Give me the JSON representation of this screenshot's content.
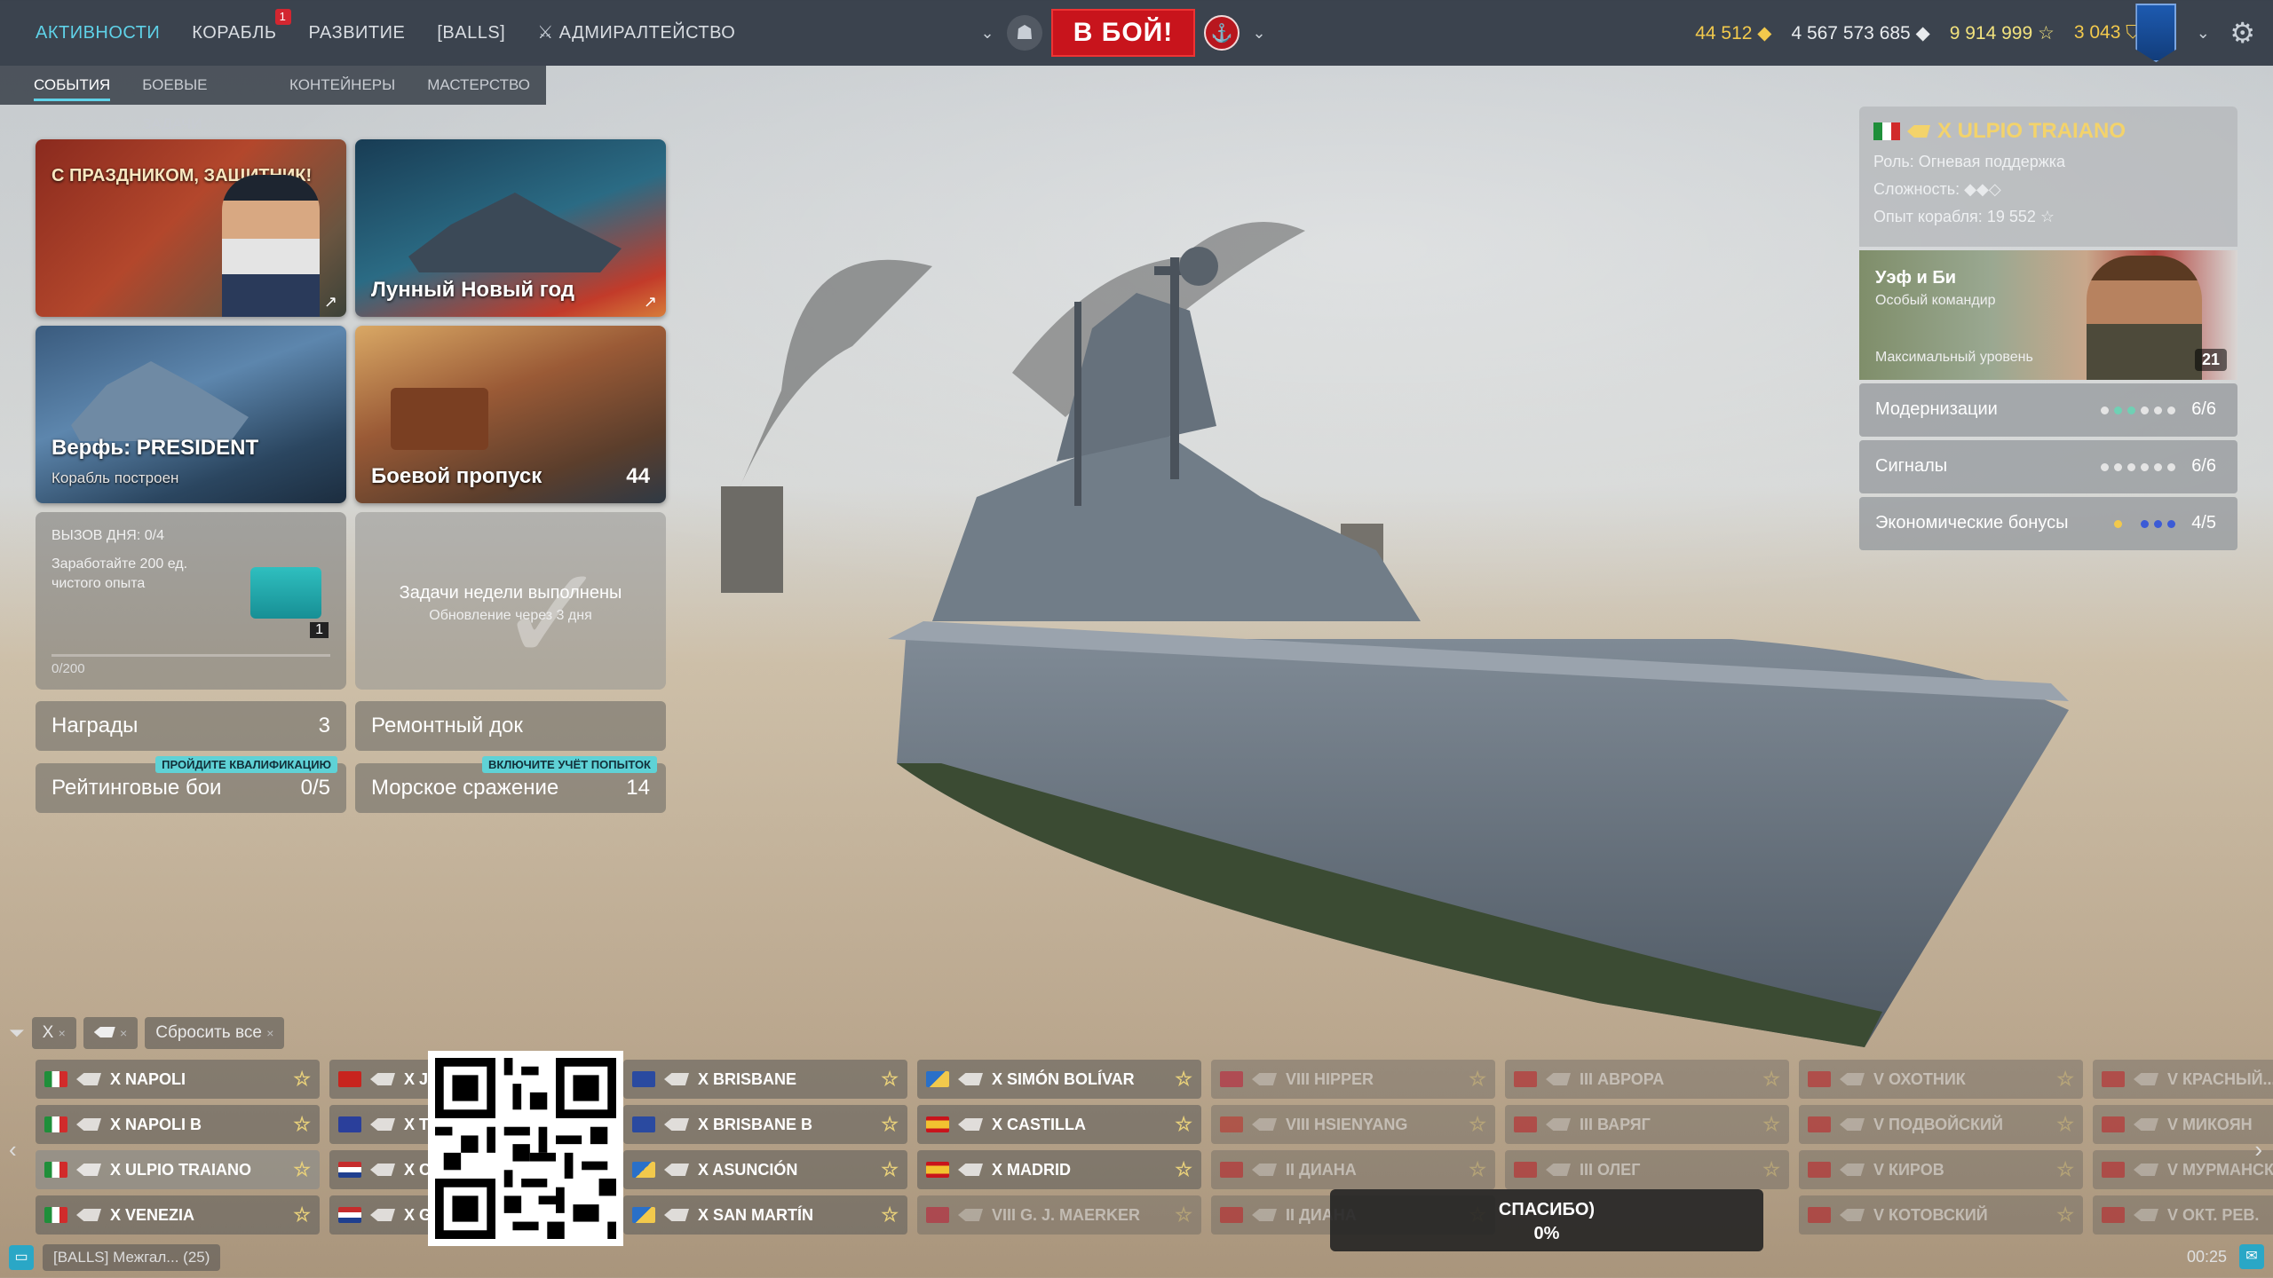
{
  "nav": {
    "items": [
      {
        "label": "АКТИВНОСТИ",
        "active": true
      },
      {
        "label": "КОРАБЛЬ",
        "badge": "1"
      },
      {
        "label": "РАЗВИТИЕ"
      },
      {
        "label": "[BALLS]"
      },
      {
        "label": "АДМИРАЛТЕЙСТВО"
      }
    ]
  },
  "battle_button": "В БОЙ!",
  "resources": {
    "doubloons": "44 512",
    "credits": "4 567 573 685",
    "free_xp": "9 914 999",
    "coal": "3 043"
  },
  "subtabs": [
    {
      "label": "СОБЫТИЯ",
      "active": true
    },
    {
      "label": "БОЕВЫЕ ЗАДАЧИ"
    },
    {
      "label": "КОНТЕЙНЕРЫ"
    },
    {
      "label": "МАСТЕРСТВО"
    }
  ],
  "events": {
    "card1": {
      "banner": "С ПРАЗДНИКОМ, ЗАЩИТНИК!"
    },
    "card2": {
      "title": "Лунный Новый год"
    },
    "card3": {
      "title": "Верфь: PRESIDENT",
      "subtitle": "Корабль построен"
    },
    "card4": {
      "title": "Боевой пропуск",
      "count": "44"
    },
    "daily": {
      "label": "ВЫЗОВ ДНЯ:",
      "value": "0/4",
      "desc": "Заработайте 200 ед. чистого опыта",
      "progress": "0/200",
      "reward_count": "1"
    },
    "weekly": {
      "title": "Задачи недели выполнены",
      "subtitle": "Обновление через 3 дня"
    },
    "rewards": {
      "label": "Награды",
      "count": "3"
    },
    "dock": {
      "label": "Ремонтный док"
    },
    "ranked": {
      "label": "Рейтинговые бои",
      "count": "0/5",
      "tag": "ПРОЙДИТЕ КВАЛИФИКАЦИЮ"
    },
    "naval": {
      "label": "Морское сражение",
      "count": "14",
      "tag": "ВКЛЮЧИТЕ УЧЁТ ПОПЫТОК"
    }
  },
  "ship_panel": {
    "name": "X ULPIO TRAIANO",
    "role": "Роль: Огневая поддержка",
    "difficulty": "Сложность:",
    "xp_label": "Опыт корабля:",
    "xp": "19 552",
    "commander": {
      "name": "Уэф и Би",
      "type": "Особый командир",
      "level": "Максимальный уровень",
      "points": "21"
    },
    "rows": [
      {
        "label": "Модернизации",
        "value": "6/6"
      },
      {
        "label": "Сигналы",
        "value": "6/6"
      },
      {
        "label": "Экономические бонусы",
        "value": "4/5"
      }
    ]
  },
  "filters": {
    "tier": "X",
    "reset": "Сбросить все"
  },
  "ships": [
    {
      "name": "X NAPOLI",
      "col": 0,
      "row": 0,
      "flag": "italy"
    },
    {
      "name": "X NAPOLI B",
      "col": 0,
      "row": 1,
      "flag": "italy"
    },
    {
      "name": "X ULPIO TRAIANO",
      "col": 0,
      "row": 2,
      "flag": "italy",
      "selected": true
    },
    {
      "name": "X VENEZIA",
      "col": 0,
      "row": 3,
      "flag": "italy"
    },
    {
      "name": "X JI...",
      "col": 1,
      "row": 0,
      "flag": "china"
    },
    {
      "name": "X T...",
      "col": 1,
      "row": 1,
      "flag": "panasia"
    },
    {
      "name": "X C...",
      "col": 1,
      "row": 2,
      "flag": "nl"
    },
    {
      "name": "X G...",
      "col": 1,
      "row": 3,
      "flag": "nl"
    },
    {
      "name": "X BRISBANE",
      "col": 2,
      "row": 0,
      "flag": "commonwealth"
    },
    {
      "name": "X BRISBANE B",
      "col": 2,
      "row": 1,
      "flag": "commonwealth"
    },
    {
      "name": "X ASUNCIÓN",
      "col": 2,
      "row": 2,
      "flag": "panamerica"
    },
    {
      "name": "X SAN MARTÍN",
      "col": 2,
      "row": 3,
      "flag": "panamerica"
    },
    {
      "name": "X SIMÓN BOLÍVAR",
      "col": 3,
      "row": 0,
      "flag": "panamerica"
    },
    {
      "name": "X CASTILLA",
      "col": 3,
      "row": 1,
      "flag": "spain"
    },
    {
      "name": "X MADRID",
      "col": 3,
      "row": 2,
      "flag": "spain"
    },
    {
      "name": "VIII G. J. MAERKER",
      "col": 3,
      "row": 3,
      "flag": "norway",
      "dim": true
    },
    {
      "name": "VIII HIPPER",
      "col": 4,
      "row": 0,
      "flag": "norway",
      "dim": true
    },
    {
      "name": "VIII HSIENYANG",
      "col": 4,
      "row": 1,
      "flag": "china",
      "dim": true
    },
    {
      "name": "II ДИАНА",
      "col": 4,
      "row": 2,
      "flag": "ussr",
      "dim": true
    },
    {
      "name": "II ДИАНА",
      "col": 4,
      "row": 3,
      "flag": "ussr",
      "dim": true
    },
    {
      "name": "III АВРОРА",
      "col": 5,
      "row": 0,
      "flag": "ussr",
      "dim": true
    },
    {
      "name": "III ВАРЯГ",
      "col": 5,
      "row": 1,
      "flag": "ussr",
      "dim": true
    },
    {
      "name": "III ОЛЕГ",
      "col": 5,
      "row": 2,
      "flag": "ussr",
      "dim": true
    },
    {
      "name": "V ОХОТНИК",
      "col": 6,
      "row": 0,
      "flag": "ussr",
      "dim": true
    },
    {
      "name": "V ПОДВОЙСКИЙ",
      "col": 6,
      "row": 1,
      "flag": "ussr",
      "dim": true
    },
    {
      "name": "V КИРОВ",
      "col": 6,
      "row": 2,
      "flag": "ussr",
      "dim": true
    },
    {
      "name": "V КОТОВСКИЙ",
      "col": 6,
      "row": 3,
      "flag": "ussr",
      "dim": true
    },
    {
      "name": "V КРАСНЫЙ...",
      "col": 7,
      "row": 0,
      "flag": "ussr",
      "dim": true
    },
    {
      "name": "V МИКОЯН",
      "col": 7,
      "row": 1,
      "flag": "ussr",
      "dim": true
    },
    {
      "name": "V МУРМАНСК",
      "col": 7,
      "row": 2,
      "flag": "ussr",
      "dim": true
    },
    {
      "name": "V ОКТ. РЕВ.",
      "col": 7,
      "row": 3,
      "flag": "ussr",
      "dim": true
    }
  ],
  "toast": {
    "line1": "СПАСИБО)",
    "line2": "0%"
  },
  "chat": {
    "text": "[BALLS] Межгал... (25)"
  },
  "clock": "00:25"
}
